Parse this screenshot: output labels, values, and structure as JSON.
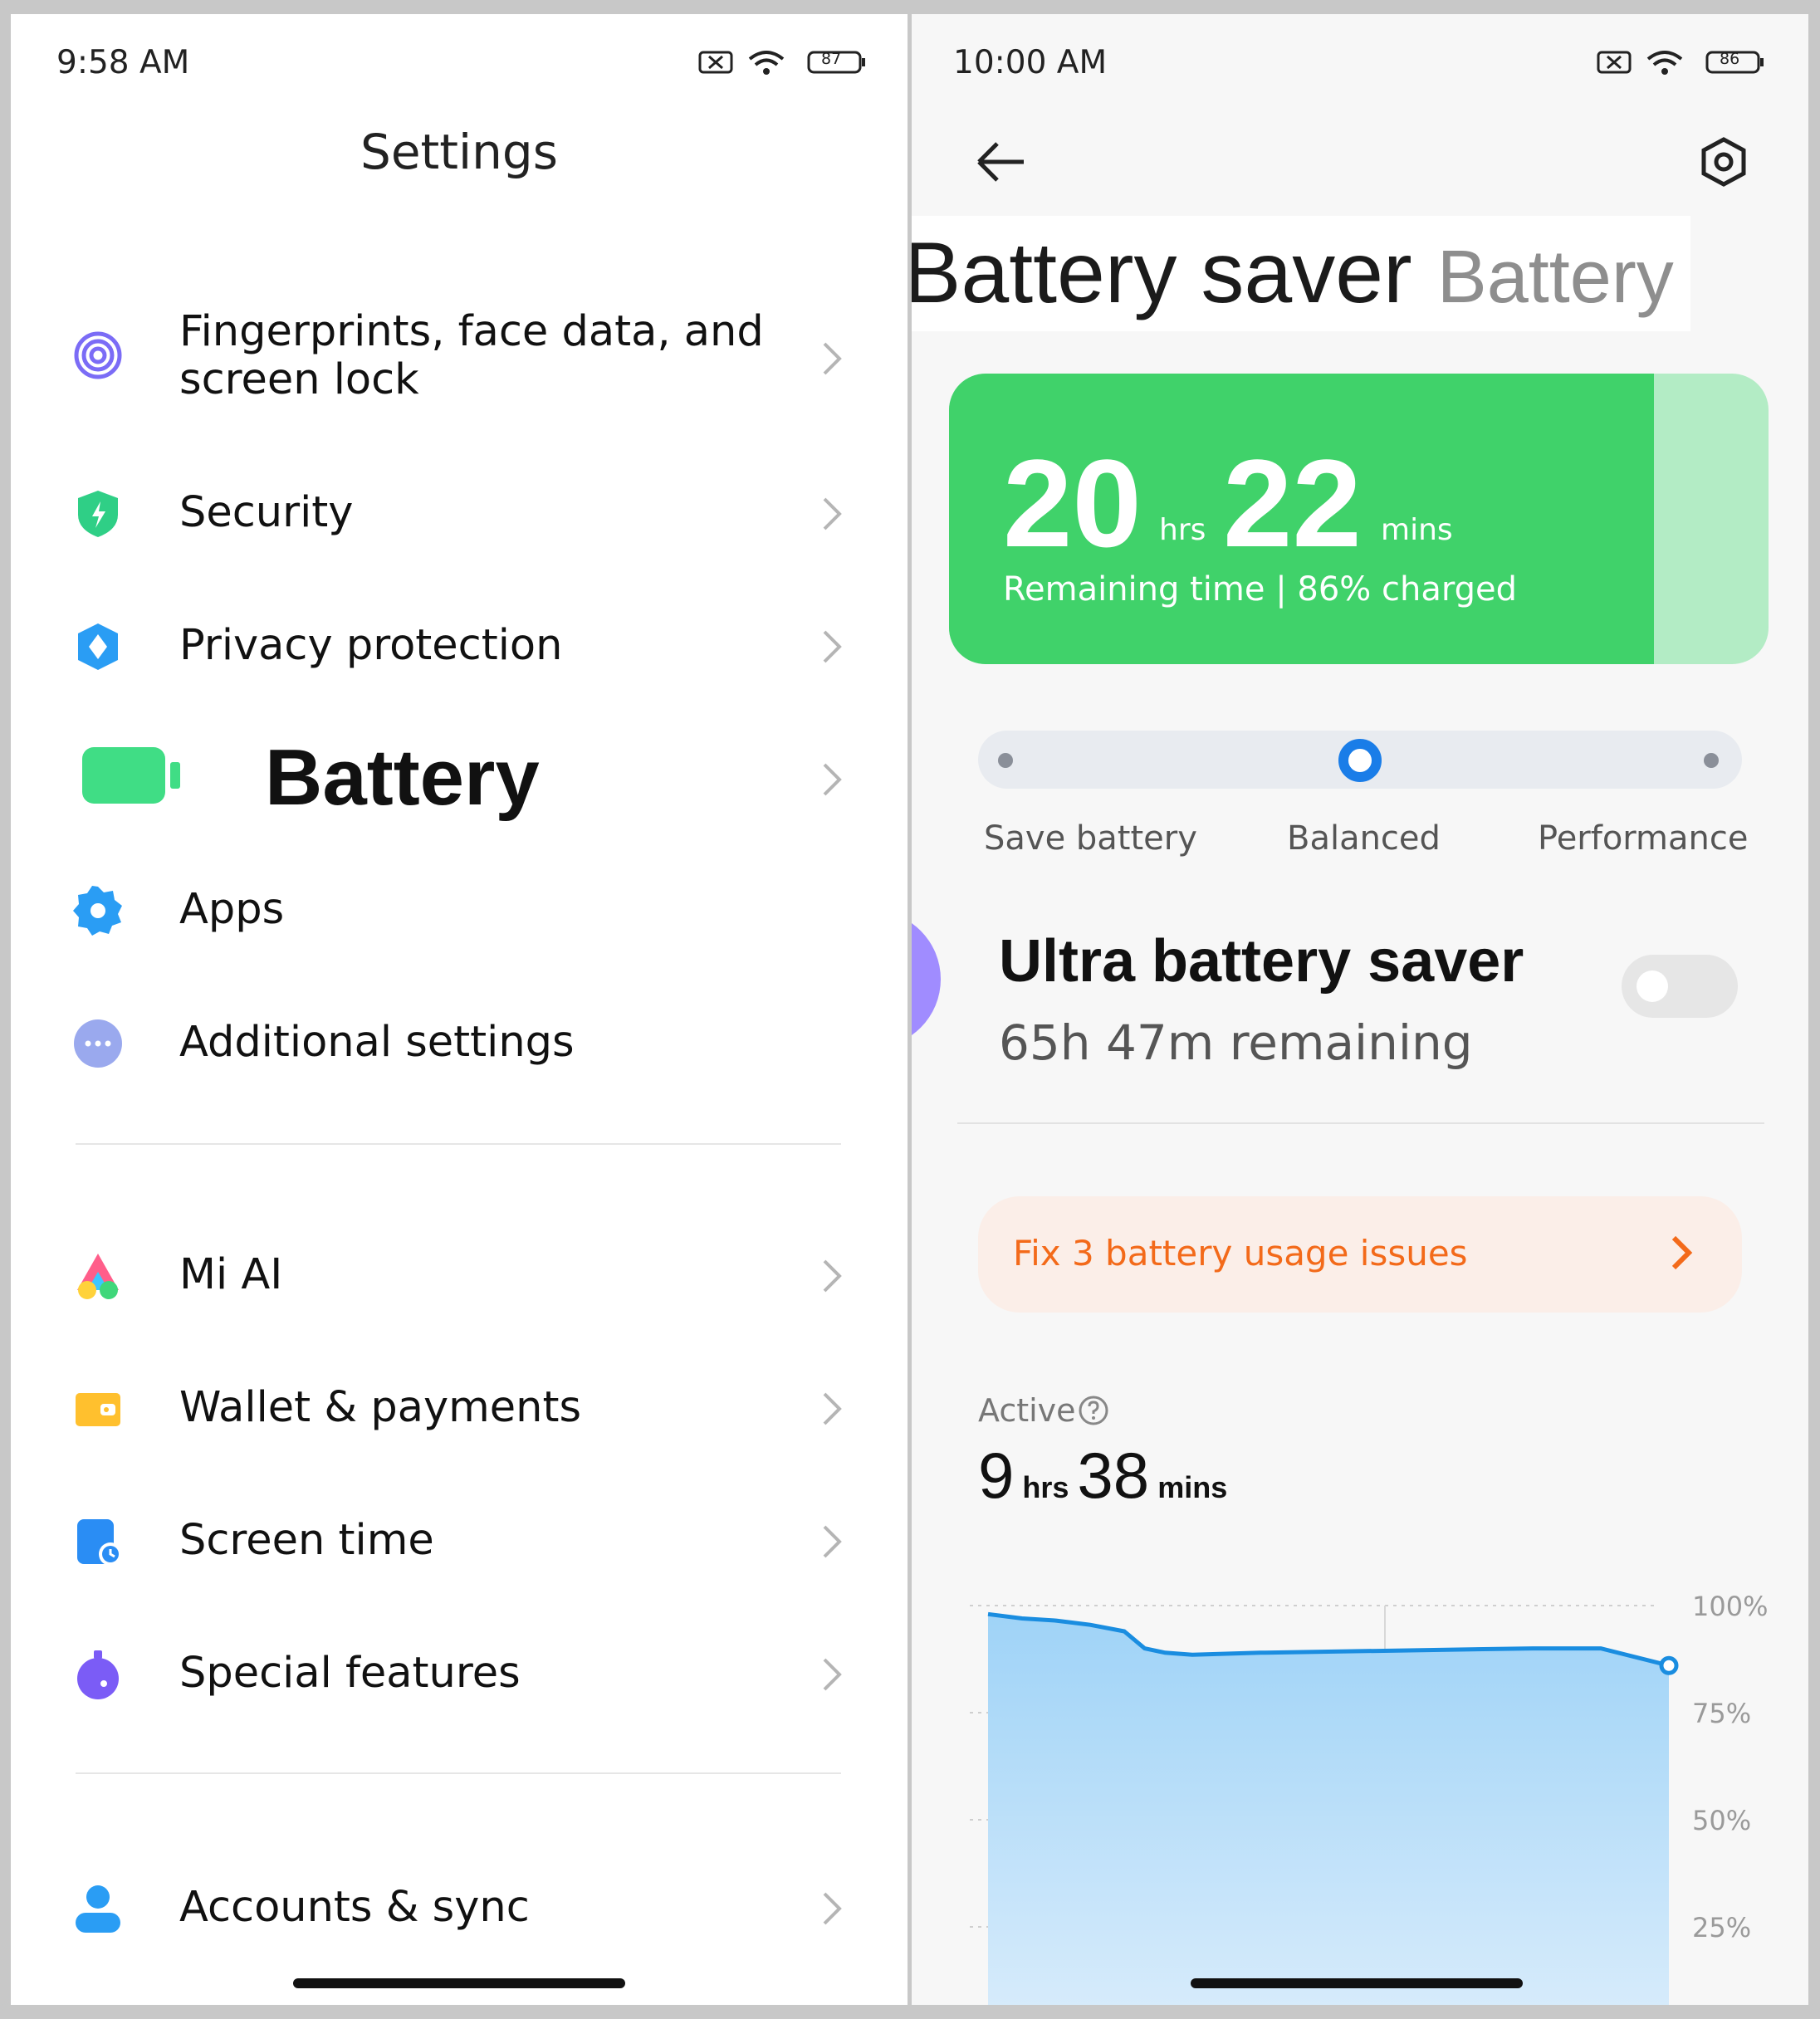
{
  "left": {
    "status_time": "9:58 AM",
    "battery_level": "87",
    "title": "Settings",
    "items": [
      {
        "label": "Fingerprints, face data, and screen lock",
        "icon": "fingerprint-icon",
        "color": "#7b6cf6"
      },
      {
        "label": "Security",
        "icon": "shield-icon",
        "color": "#2fcf86"
      },
      {
        "label": "Privacy protection",
        "icon": "privacy-icon",
        "color": "#2a9df4"
      },
      {
        "label": "Battery",
        "icon": "battery-icon",
        "color": "#40dd85"
      },
      {
        "label": "Apps",
        "icon": "apps-gear-icon",
        "color": "#2a9df4"
      },
      {
        "label": "Additional settings",
        "icon": "more-dots-icon",
        "color": "#9aa9ee"
      },
      {
        "label": "Mi AI",
        "icon": "mi-ai-icon",
        "color": "#ff5e8a"
      },
      {
        "label": "Wallet & payments",
        "icon": "wallet-icon",
        "color": "#ffc02e"
      },
      {
        "label": "Screen time",
        "icon": "screen-time-icon",
        "color": "#2a8df4"
      },
      {
        "label": "Special features",
        "icon": "special-features-icon",
        "color": "#7b5cf6"
      },
      {
        "label": "Accounts & sync",
        "icon": "account-icon",
        "color": "#2a9df4"
      }
    ]
  },
  "right": {
    "status_time": "10:00 AM",
    "battery_level": "86",
    "title": "Battery saver",
    "title_sub": "Battery",
    "remaining": {
      "hours": "20",
      "hours_unit": "hrs",
      "mins": "22",
      "mins_unit": "mins",
      "caption": "Remaining time | 86% charged",
      "charge_percent": 86
    },
    "modes": [
      "Save battery",
      "Balanced",
      "Performance"
    ],
    "selected_mode": "Balanced",
    "ultra": {
      "title": "Ultra battery saver",
      "subtitle": "65h 47m remaining",
      "enabled": false
    },
    "fix_text": "Fix 3 battery usage issues",
    "active_label": "Active",
    "active_time": {
      "hours": "9",
      "hours_unit": "hrs",
      "mins": "38",
      "mins_unit": "mins"
    },
    "colors": {
      "accent_green": "#40d26a",
      "accent_blue": "#1a7de8",
      "warning_orange": "#f36a1a"
    }
  },
  "chart_data": {
    "type": "area",
    "y_ticks": [
      "100%",
      "75%",
      "50%",
      "25%"
    ],
    "ylim": [
      0,
      100
    ],
    "x": [
      0,
      5,
      10,
      15,
      20,
      23,
      26,
      30,
      40,
      60,
      80,
      90,
      100
    ],
    "values": [
      98,
      97,
      96.5,
      95.5,
      94,
      90,
      89,
      88.5,
      89,
      89.5,
      90,
      90,
      86
    ]
  }
}
